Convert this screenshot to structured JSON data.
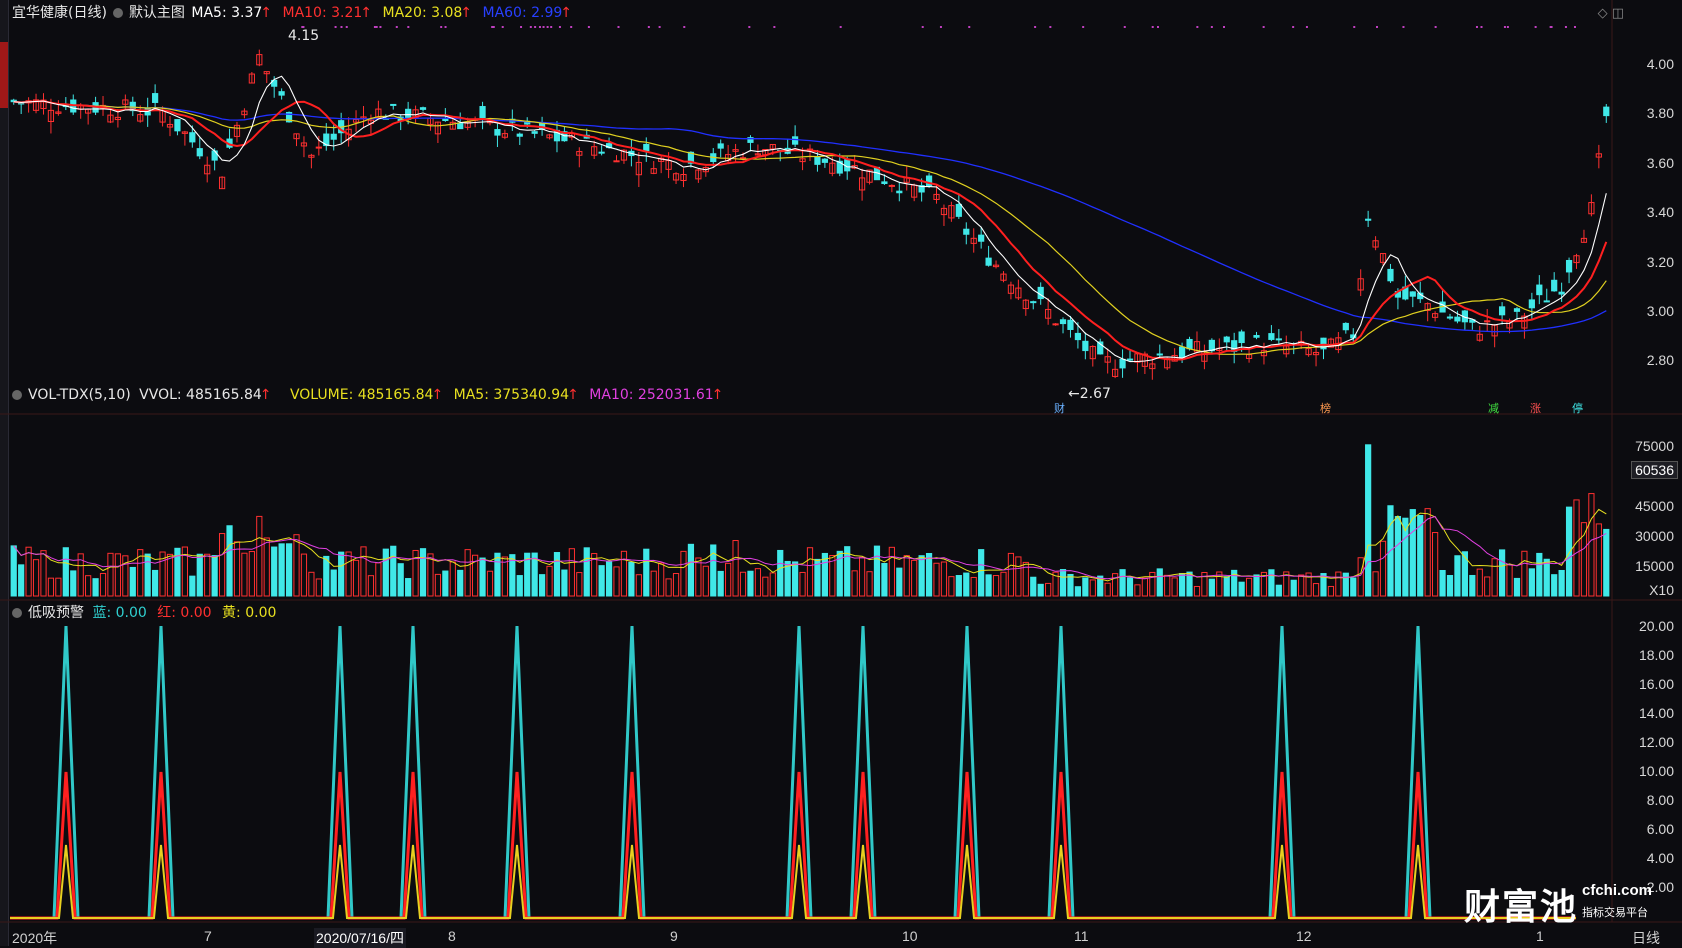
{
  "window": {
    "title": "宜华健康(日线)"
  },
  "price_panel": {
    "main_label": "默认主图",
    "ma5": "MA5: 3.37",
    "ma10": "MA10: 3.21",
    "ma20": "MA20: 3.08",
    "ma60": "MA60: 2.99",
    "high_note": "4.15",
    "low_note": "←2.67",
    "yticks": [
      "4.00",
      "3.80",
      "3.60",
      "3.40",
      "3.20",
      "3.00",
      "2.80"
    ],
    "tags": [
      "财",
      "榜",
      "减",
      "涨",
      "停"
    ],
    "colors": {
      "ma5": "#ffffff",
      "ma10": "#ff2020",
      "ma20": "#e0d020",
      "ma60": "#2030ff",
      "up": "#ff3030",
      "down": "#40e8e8"
    }
  },
  "volume_panel": {
    "label": "VOL-TDX(5,10)",
    "vvol": "VVOL: 485165.84",
    "volume": "VOLUME: 485165.84",
    "ma5": "MA5: 375340.94",
    "ma10": "MA10: 252031.61",
    "yticks": [
      "75000",
      "45000",
      "30000",
      "15000"
    ],
    "highlight": "60536",
    "unit": "X10"
  },
  "signal_panel": {
    "label": "低吸预警",
    "blue": "蓝: 0.00",
    "red": "红: 0.00",
    "yellow": "黄: 0.00",
    "yticks": [
      "20.00",
      "18.00",
      "16.00",
      "14.00",
      "12.00",
      "10.00",
      "8.00",
      "6.00",
      "4.00",
      "2.00"
    ]
  },
  "x_axis": {
    "labels": [
      "2020年",
      "7",
      "2020/07/16/四",
      "8",
      "9",
      "10",
      "11",
      "12",
      "1"
    ],
    "period": "日线"
  },
  "brand": {
    "name": "财富池",
    "url": "cfchi.com",
    "slogan": "指标交易平台"
  }
}
